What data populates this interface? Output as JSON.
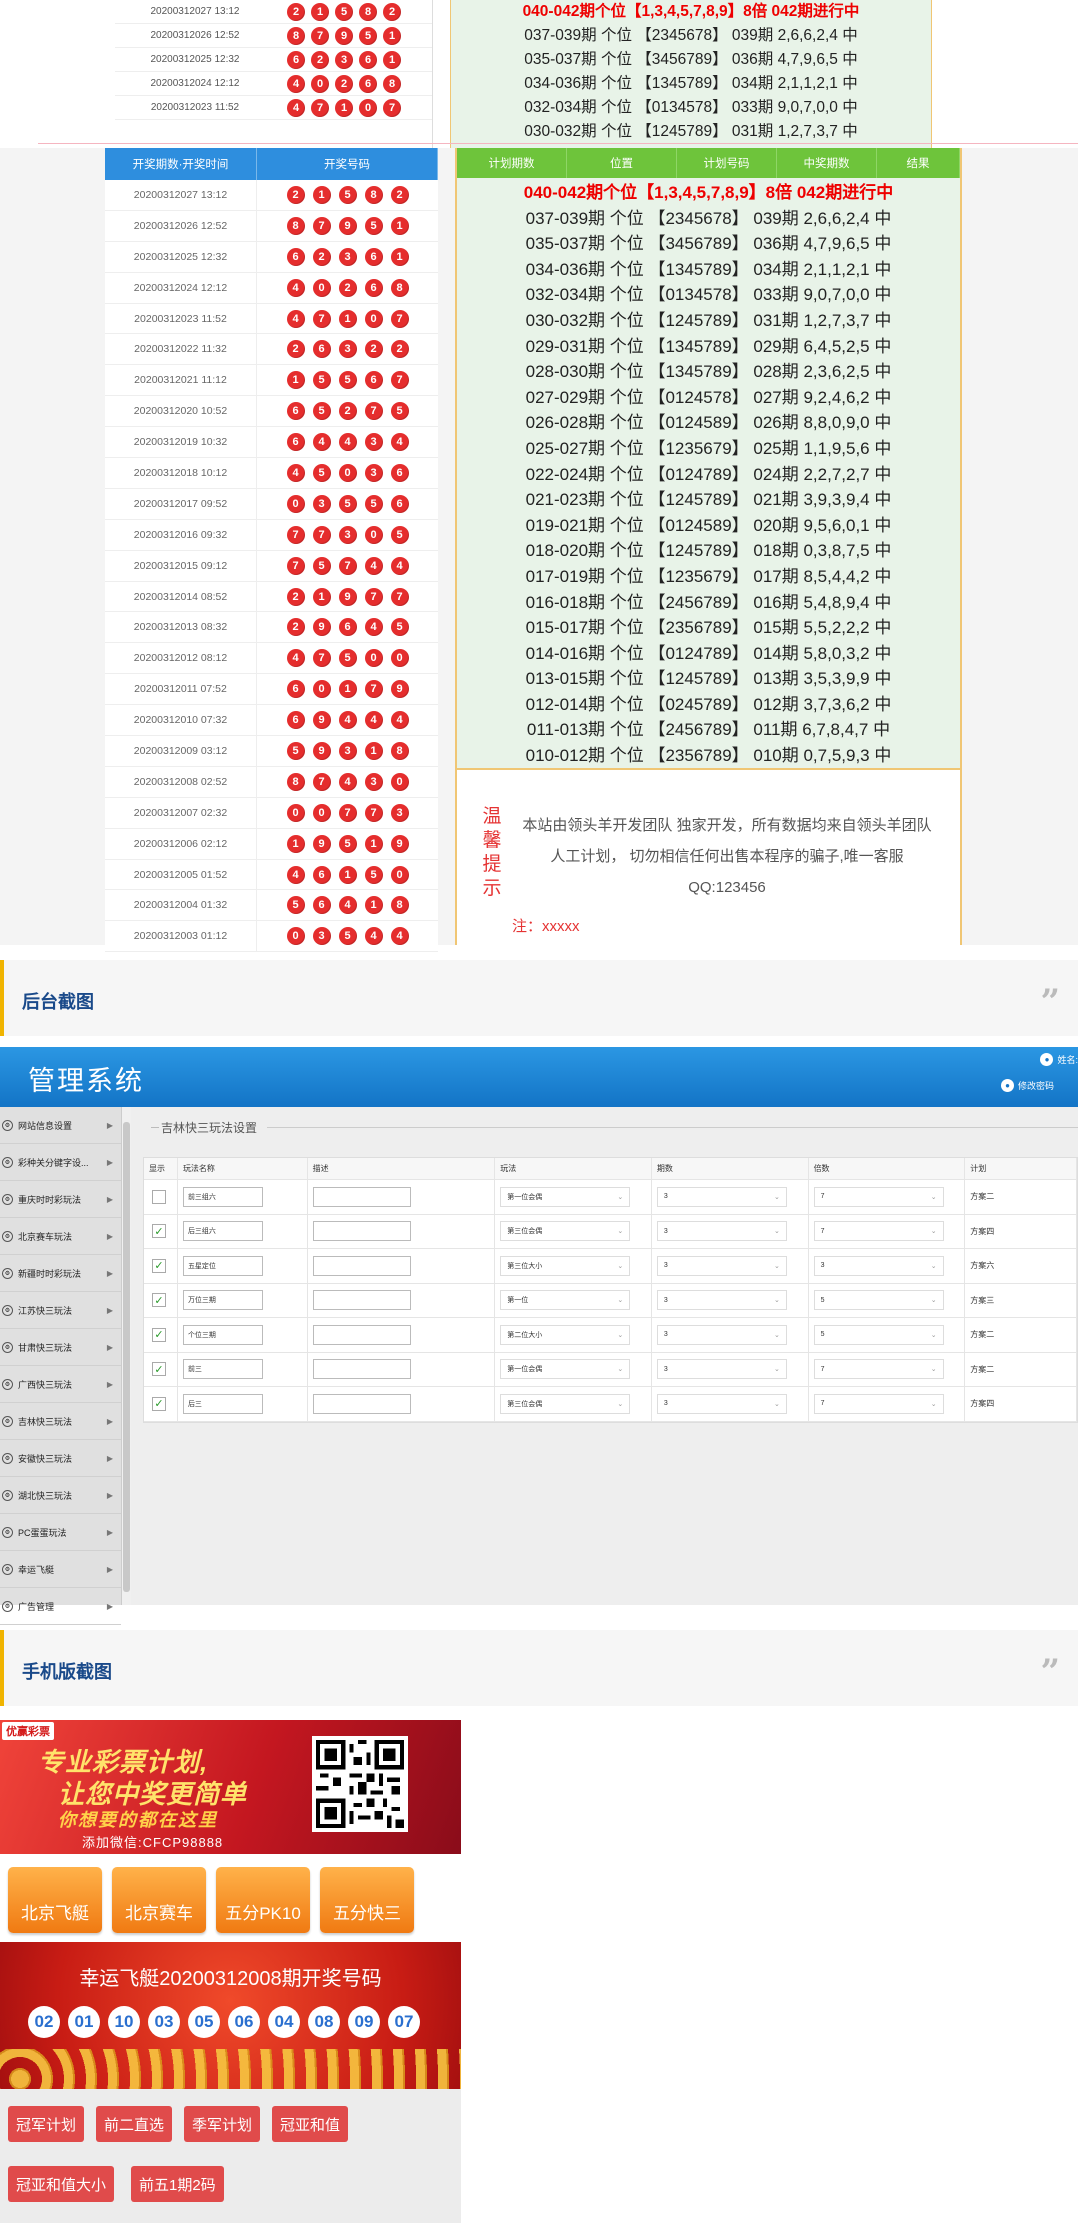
{
  "top_section": {
    "rows": [
      {
        "time": "20200312027 13:12",
        "balls": [
          "2",
          "1",
          "5",
          "8",
          "2"
        ]
      },
      {
        "time": "20200312026 12:52",
        "balls": [
          "8",
          "7",
          "9",
          "5",
          "1"
        ]
      },
      {
        "time": "20200312025 12:32",
        "balls": [
          "6",
          "2",
          "3",
          "6",
          "1"
        ]
      },
      {
        "time": "20200312024 12:12",
        "balls": [
          "4",
          "0",
          "2",
          "6",
          "8"
        ]
      },
      {
        "time": "20200312023 11:52",
        "balls": [
          "4",
          "7",
          "1",
          "0",
          "7"
        ]
      }
    ],
    "plans": [
      {
        "text": "040-042期个位【1,3,4,5,7,8,9】8倍 042期进行中",
        "highlight": true
      },
      {
        "text": "037-039期 个位 【2345678】 039期 2,6,6,2,4 中",
        "highlight": false
      },
      {
        "text": "035-037期 个位 【3456789】 036期 4,7,9,6,5 中",
        "highlight": false
      },
      {
        "text": "034-036期 个位 【1345789】 034期 2,1,1,2,1 中",
        "highlight": false
      },
      {
        "text": "032-034期 个位 【0134578】 033期 9,0,7,0,0 中",
        "highlight": false
      },
      {
        "text": "030-032期 个位 【1245789】 031期 1,2,7,3,7 中",
        "highlight": false
      }
    ]
  },
  "lottery_table": {
    "headers": [
      "开奖期数·开奖时间",
      "开奖号码"
    ],
    "rows": [
      {
        "time": "20200312027 13:12",
        "balls": [
          "2",
          "1",
          "5",
          "8",
          "2"
        ]
      },
      {
        "time": "20200312026 12:52",
        "balls": [
          "8",
          "7",
          "9",
          "5",
          "1"
        ]
      },
      {
        "time": "20200312025 12:32",
        "balls": [
          "6",
          "2",
          "3",
          "6",
          "1"
        ]
      },
      {
        "time": "20200312024 12:12",
        "balls": [
          "4",
          "0",
          "2",
          "6",
          "8"
        ]
      },
      {
        "time": "20200312023 11:52",
        "balls": [
          "4",
          "7",
          "1",
          "0",
          "7"
        ]
      },
      {
        "time": "20200312022 11:32",
        "balls": [
          "2",
          "6",
          "3",
          "2",
          "2"
        ]
      },
      {
        "time": "20200312021 11:12",
        "balls": [
          "1",
          "5",
          "5",
          "6",
          "7"
        ]
      },
      {
        "time": "20200312020 10:52",
        "balls": [
          "6",
          "5",
          "2",
          "7",
          "5"
        ]
      },
      {
        "time": "20200312019 10:32",
        "balls": [
          "6",
          "4",
          "4",
          "3",
          "4"
        ]
      },
      {
        "time": "20200312018 10:12",
        "balls": [
          "4",
          "5",
          "0",
          "3",
          "6"
        ]
      },
      {
        "time": "20200312017 09:52",
        "balls": [
          "0",
          "3",
          "5",
          "5",
          "6"
        ]
      },
      {
        "time": "20200312016 09:32",
        "balls": [
          "7",
          "7",
          "3",
          "0",
          "5"
        ]
      },
      {
        "time": "20200312015 09:12",
        "balls": [
          "7",
          "5",
          "7",
          "4",
          "4"
        ]
      },
      {
        "time": "20200312014 08:52",
        "balls": [
          "2",
          "1",
          "9",
          "7",
          "7"
        ]
      },
      {
        "time": "20200312013 08:32",
        "balls": [
          "2",
          "9",
          "6",
          "4",
          "5"
        ]
      },
      {
        "time": "20200312012 08:12",
        "balls": [
          "4",
          "7",
          "5",
          "0",
          "0"
        ]
      },
      {
        "time": "20200312011 07:52",
        "balls": [
          "6",
          "0",
          "1",
          "7",
          "9"
        ]
      },
      {
        "time": "20200312010 07:32",
        "balls": [
          "6",
          "9",
          "4",
          "4",
          "4"
        ]
      },
      {
        "time": "20200312009 03:12",
        "balls": [
          "5",
          "9",
          "3",
          "1",
          "8"
        ]
      },
      {
        "time": "20200312008 02:52",
        "balls": [
          "8",
          "7",
          "4",
          "3",
          "0"
        ]
      },
      {
        "time": "20200312007 02:32",
        "balls": [
          "0",
          "0",
          "7",
          "7",
          "3"
        ]
      },
      {
        "time": "20200312006 02:12",
        "balls": [
          "1",
          "9",
          "5",
          "1",
          "9"
        ]
      },
      {
        "time": "20200312005 01:52",
        "balls": [
          "4",
          "6",
          "1",
          "5",
          "0"
        ]
      },
      {
        "time": "20200312004 01:32",
        "balls": [
          "5",
          "6",
          "4",
          "1",
          "8"
        ]
      },
      {
        "time": "20200312003 01:12",
        "balls": [
          "0",
          "3",
          "5",
          "4",
          "4"
        ]
      }
    ]
  },
  "plan_table": {
    "headers": [
      "计划期数",
      "位置",
      "计划号码",
      "中奖期数",
      "结果"
    ],
    "rows": [
      {
        "text": "040-042期个位【1,3,4,5,7,8,9】8倍 042期进行中",
        "highlight": true
      },
      {
        "text": "037-039期 个位 【2345678】 039期 2,6,6,2,4 中",
        "highlight": false
      },
      {
        "text": "035-037期 个位 【3456789】 036期 4,7,9,6,5 中",
        "highlight": false
      },
      {
        "text": "034-036期 个位 【1345789】 034期 2,1,1,2,1 中",
        "highlight": false
      },
      {
        "text": "032-034期 个位 【0134578】 033期 9,0,7,0,0 中",
        "highlight": false
      },
      {
        "text": "030-032期 个位 【1245789】 031期 1,2,7,3,7 中",
        "highlight": false
      },
      {
        "text": "029-031期 个位 【1345789】 029期 6,4,5,2,5 中",
        "highlight": false
      },
      {
        "text": "028-030期 个位 【1345789】 028期 2,3,6,2,5 中",
        "highlight": false
      },
      {
        "text": "027-029期 个位 【0124578】 027期 9,2,4,6,2 中",
        "highlight": false
      },
      {
        "text": "026-028期 个位 【0124589】 026期 8,8,0,9,0 中",
        "highlight": false
      },
      {
        "text": "025-027期 个位 【1235679】 025期 1,1,9,5,6 中",
        "highlight": false
      },
      {
        "text": "022-024期 个位 【0124789】 024期 2,2,7,2,7 中",
        "highlight": false
      },
      {
        "text": "021-023期 个位 【1245789】 021期 3,9,3,9,4 中",
        "highlight": false
      },
      {
        "text": "019-021期 个位 【0124589】 020期 9,5,6,0,1 中",
        "highlight": false
      },
      {
        "text": "018-020期 个位 【1245789】 018期 0,3,8,7,5 中",
        "highlight": false
      },
      {
        "text": "017-019期 个位 【1235679】 017期 8,5,4,4,2 中",
        "highlight": false
      },
      {
        "text": "016-018期 个位 【2456789】 016期 5,4,8,9,4 中",
        "highlight": false
      },
      {
        "text": "015-017期 个位 【2356789】 015期 5,5,2,2,2 中",
        "highlight": false
      },
      {
        "text": "014-016期 个位 【0124789】 014期 5,8,0,3,2 中",
        "highlight": false
      },
      {
        "text": "013-015期 个位 【1245789】 013期 3,5,3,9,9 中",
        "highlight": false
      },
      {
        "text": "012-014期 个位 【0245789】 012期 3,7,3,6,2 中",
        "highlight": false
      },
      {
        "text": "011-013期 个位 【2456789】 011期 6,7,8,4,7 中",
        "highlight": false
      },
      {
        "text": "010-012期 个位 【2356789】 010期 0,7,5,9,3 中",
        "highlight": false
      }
    ]
  },
  "tips": {
    "vertical": "温馨提示",
    "body": "本站由领头羊开发团队 独家开发，所有数据均来自领头羊团队人工计划， 切勿相信任何出售本程序的骗子,唯一客服QQ:123456",
    "note": "注：xxxxx"
  },
  "section_backend": {
    "title": "后台截图",
    "quote": "”"
  },
  "admin": {
    "brand": "管理系统",
    "user": "姓名:",
    "change_password": "修改密码",
    "breadcrumb": "吉林快三玩法设置",
    "sidebar": [
      "网站信息设置",
      "彩种关分键字设...",
      "重庆时时彩玩法",
      "北京赛车玩法",
      "新疆时时彩玩法",
      "江苏快三玩法",
      "甘肃快三玩法",
      "广西快三玩法",
      "吉林快三玩法",
      "安徽快三玩法",
      "湖北快三玩法",
      "PC蛋蛋玩法",
      "幸运飞艇",
      "广告管理"
    ],
    "table_headers": [
      "显示",
      "玩法名称",
      "描述",
      "玩法",
      "期数",
      "倍数",
      "计划"
    ],
    "rows": [
      {
        "checked": false,
        "name": "前三组六",
        "desc": "",
        "play": "第一位会偶",
        "periods": "3",
        "multiple": "7",
        "plan": "方案二"
      },
      {
        "checked": true,
        "name": "后三组六",
        "desc": "",
        "play": "第三位会偶",
        "periods": "3",
        "multiple": "7",
        "plan": "方案四"
      },
      {
        "checked": true,
        "name": "五星定位",
        "desc": "",
        "play": "第三位大小",
        "periods": "3",
        "multiple": "3",
        "plan": "方案六"
      },
      {
        "checked": true,
        "name": "万位三期",
        "desc": "",
        "play": "第一位",
        "periods": "3",
        "multiple": "5",
        "plan": "方案三"
      },
      {
        "checked": true,
        "name": "个位三期",
        "desc": "",
        "play": "第二位大小",
        "periods": "3",
        "multiple": "5",
        "plan": "方案二"
      },
      {
        "checked": true,
        "name": "前三",
        "desc": "",
        "play": "第一位会偶",
        "periods": "3",
        "multiple": "7",
        "plan": "方案二"
      },
      {
        "checked": true,
        "name": "后三",
        "desc": "",
        "play": "第三位会偶",
        "periods": "3",
        "multiple": "7",
        "plan": "方案四"
      }
    ]
  },
  "section_mobile": {
    "title": "手机版截图",
    "quote": "”"
  },
  "mobile": {
    "logo": "优赢彩票",
    "slogan1": "专业彩票计划,",
    "slogan2": "让您中奖更简单",
    "slogan3": "你想要的都在这里",
    "wechat": "添加微信:CFCP98888",
    "games": [
      "北京飞艇",
      "北京赛车",
      "五分PK10",
      "五分快三"
    ],
    "draw_title": "幸运飞艇20200312008期开奖号码",
    "draw_numbers": [
      "02",
      "01",
      "10",
      "03",
      "05",
      "06",
      "04",
      "08",
      "09",
      "07"
    ],
    "tabs_row1": [
      "冠军计划",
      "前二直选",
      "季军计划",
      "冠亚和值"
    ],
    "tabs_row2": [
      "冠亚和值大小",
      "前五1期2码"
    ]
  },
  "colors": {
    "ball": "#e52d2d",
    "blue_header": "#2e8ede",
    "green_header": "#6ec43b",
    "highlight": "#e00000",
    "accent_bar": "#f0b400"
  }
}
